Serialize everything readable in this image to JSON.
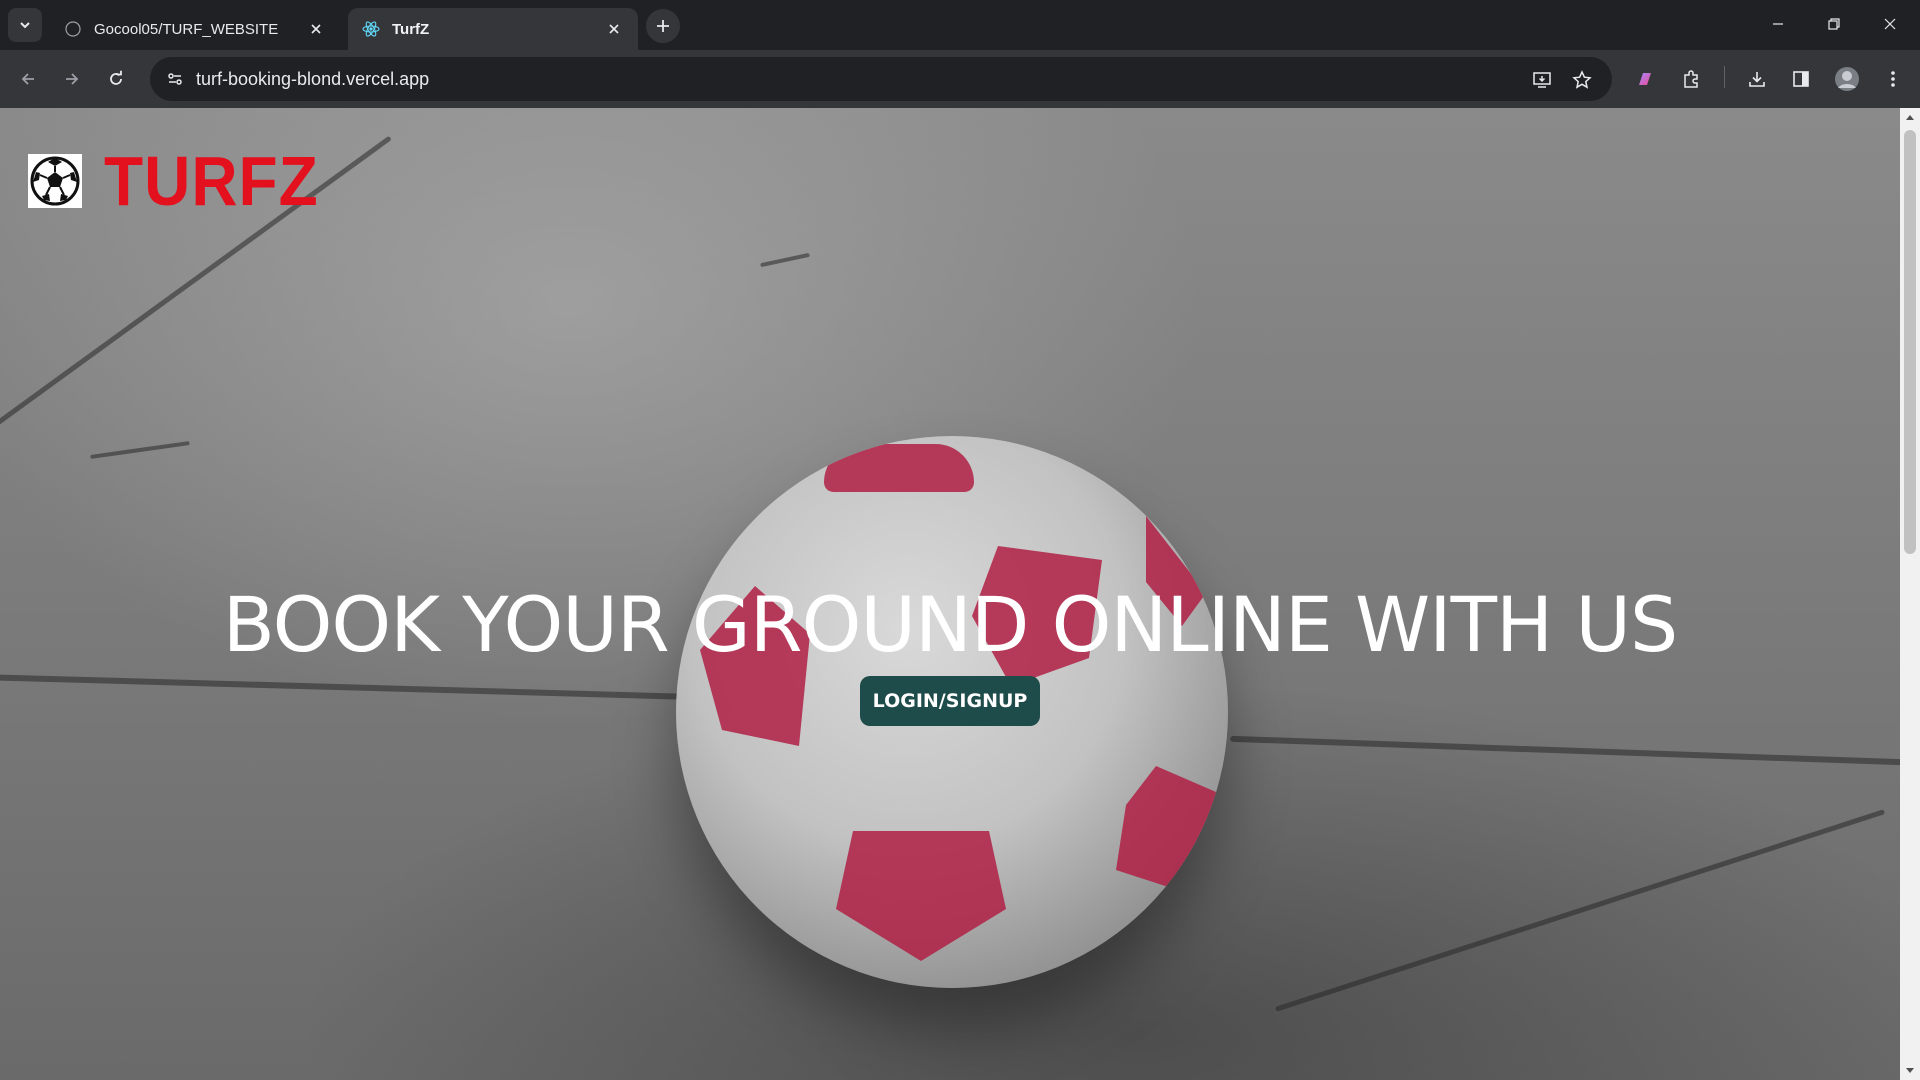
{
  "browser": {
    "tabs": [
      {
        "title": "Gocool05/TURF_WEBSITE",
        "icon": "github-icon",
        "active": false
      },
      {
        "title": "TurfZ",
        "icon": "react-icon",
        "active": true
      }
    ],
    "address_bar": {
      "url": "turf-booking-blond.vercel.app"
    }
  },
  "page": {
    "brand": {
      "name": "TURFZ",
      "color": "#e3101e"
    },
    "hero": {
      "headline": "BOOK YOUR GROUND ONLINE WITH US",
      "cta_label": "LOGIN/SIGNUP",
      "cta_color": "#1d4c4a"
    }
  }
}
